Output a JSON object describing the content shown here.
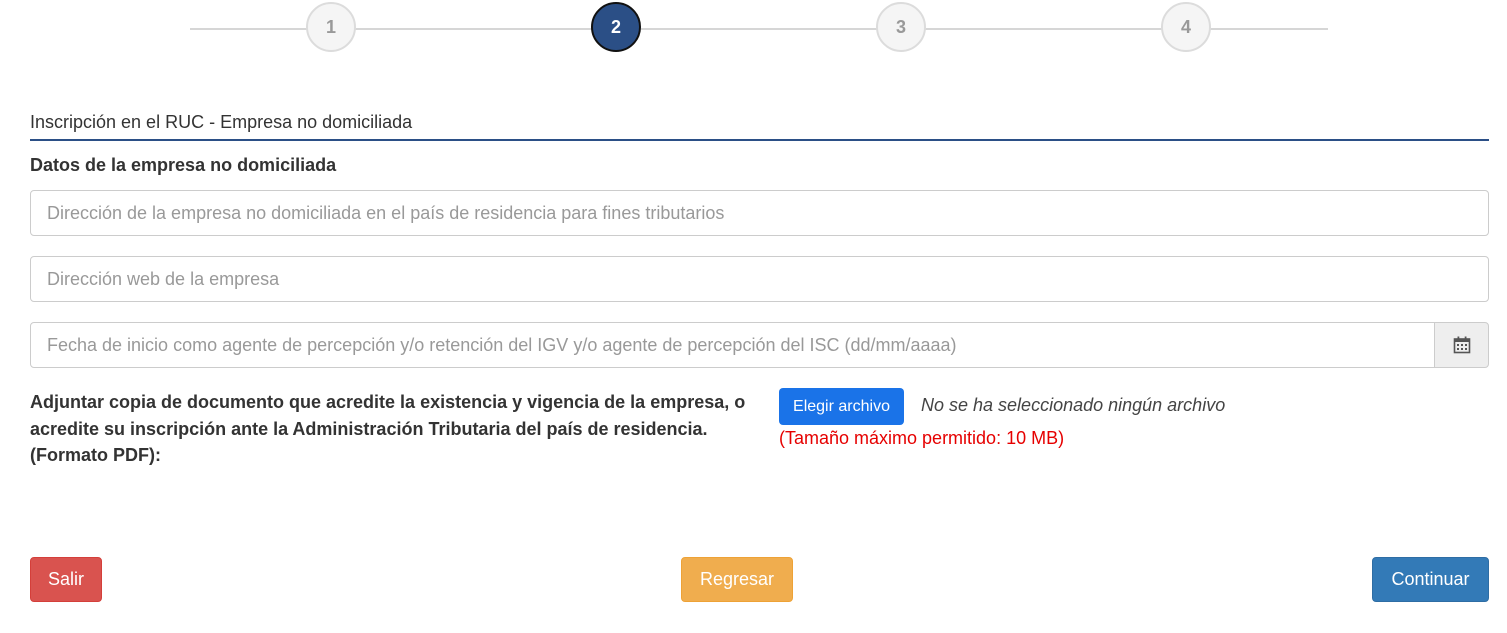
{
  "stepper": {
    "steps": [
      "1",
      "2",
      "3",
      "4"
    ],
    "active_step": 2
  },
  "section": {
    "title": "Inscripción en el RUC - Empresa no domiciliada",
    "subtitle": "Datos de la empresa no domiciliada"
  },
  "form": {
    "address_placeholder": "Dirección de la empresa no domiciliada en el país de residencia para fines tributarios",
    "address_value": "",
    "website_placeholder": "Dirección web de la empresa",
    "website_value": "",
    "date_placeholder": "Fecha de inicio como agente de percepción y/o retención del IGV y/o agente de percepción del ISC (dd/mm/aaaa)",
    "date_value": "",
    "date_icon": "calendar-icon"
  },
  "attachment": {
    "label": "Adjuntar copia de documento que acredite la existencia y vigencia de la empresa, o acredite su inscripción ante la Administración Tributaria del país de residencia. (Formato PDF):",
    "button_label": "Elegir archivo",
    "status": "No se ha seleccionado ningún archivo",
    "limit_note": "(Tamaño máximo permitido: 10 MB)"
  },
  "actions": {
    "exit_label": "Salir",
    "back_label": "Regresar",
    "continue_label": "Continuar"
  },
  "colors": {
    "primary": "#2b4f86",
    "file_button": "#1a73e8",
    "danger": "#d9534f",
    "warning": "#f0ad4e",
    "continue": "#337ab7",
    "limit_note": "#e60000"
  }
}
